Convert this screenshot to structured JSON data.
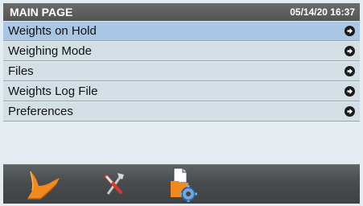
{
  "header": {
    "title": "MAIN PAGE",
    "datetime": "05/14/20 16:37"
  },
  "menu": {
    "items": [
      {
        "label": "Weights on Hold",
        "selected": true,
        "icon": "arrow-right-circle-icon"
      },
      {
        "label": "Weighing Mode",
        "selected": false,
        "icon": "arrow-right-circle-icon"
      },
      {
        "label": "Files",
        "selected": false,
        "icon": "arrow-right-circle-icon"
      },
      {
        "label": "Weights Log File",
        "selected": false,
        "icon": "arrow-right-circle-icon"
      },
      {
        "label": "Preferences",
        "selected": false,
        "icon": "arrow-right-circle-icon"
      }
    ]
  },
  "toolbar": {
    "buttons": [
      {
        "icon": "scale-weighing-icon"
      },
      {
        "icon": "tools-icon"
      },
      {
        "icon": "file-settings-icon"
      }
    ]
  },
  "colors": {
    "header_bg": "#5e5e5e",
    "selected_row": "#a9c7e4",
    "row": "#d4dee5",
    "accent_orange": "#f08a1c"
  }
}
